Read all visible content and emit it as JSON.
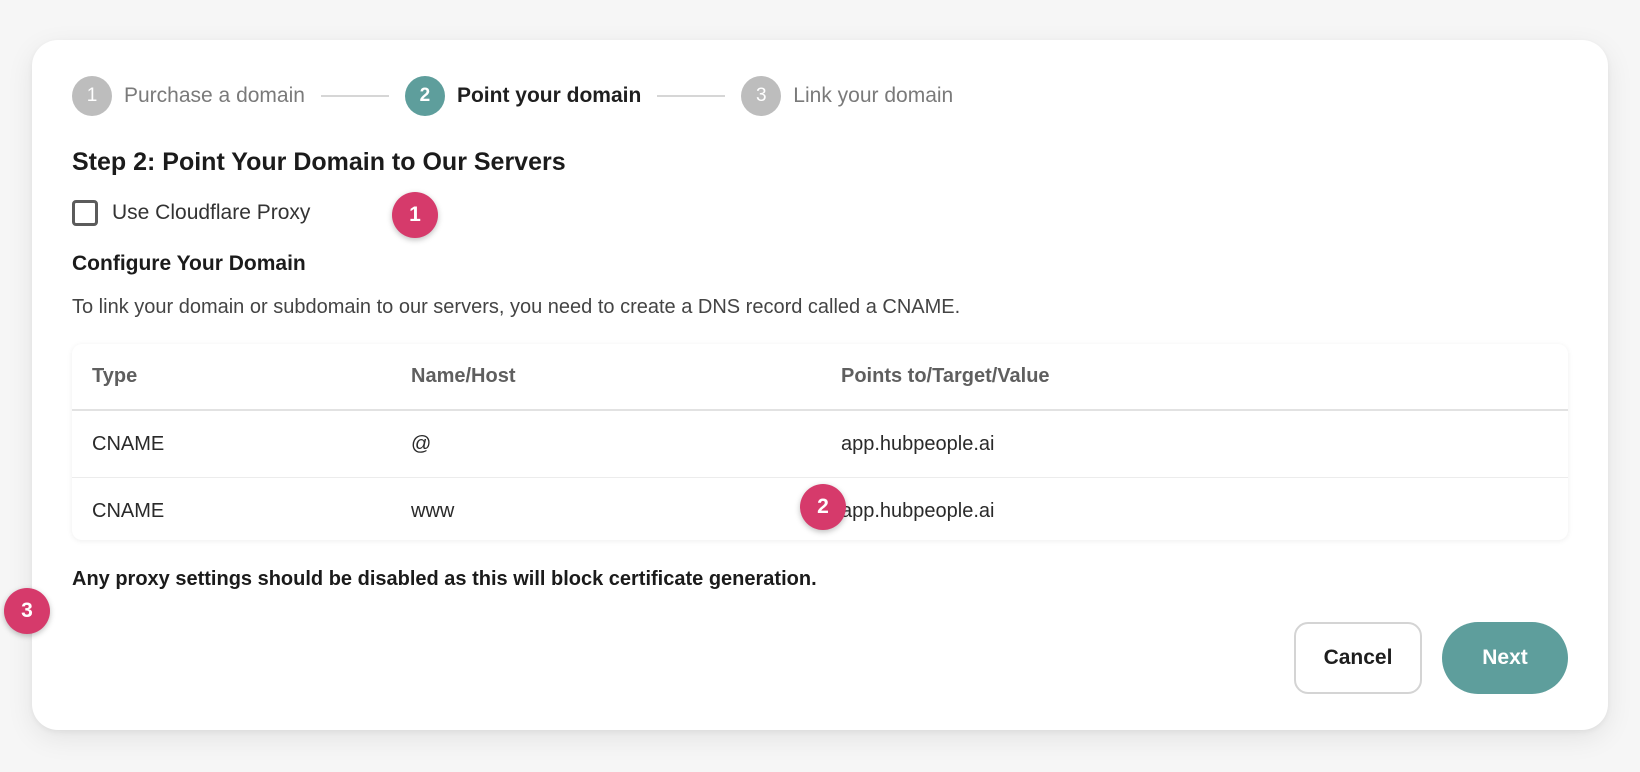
{
  "stepper": {
    "steps": [
      {
        "number": "1",
        "label": "Purchase a domain"
      },
      {
        "number": "2",
        "label": "Point your domain"
      },
      {
        "number": "3",
        "label": "Link your domain"
      }
    ]
  },
  "title": "Step 2: Point Your Domain to Our Servers",
  "proxy_checkbox": {
    "label": "Use Cloudflare Proxy"
  },
  "configure": {
    "heading": "Configure Your Domain",
    "description": "To link your domain or subdomain to our servers, you need to create a DNS record called a CNAME."
  },
  "dns_table": {
    "headers": [
      "Type",
      "Name/Host",
      "Points to/Target/Value"
    ],
    "rows": [
      [
        "CNAME",
        "@",
        "app.hubpeople.ai"
      ],
      [
        "CNAME",
        "www",
        "app.hubpeople.ai"
      ]
    ]
  },
  "warning": "Any proxy settings should be disabled as this will block certificate generation.",
  "buttons": {
    "cancel": "Cancel",
    "next": "Next"
  },
  "markers": [
    "1",
    "2",
    "3"
  ]
}
